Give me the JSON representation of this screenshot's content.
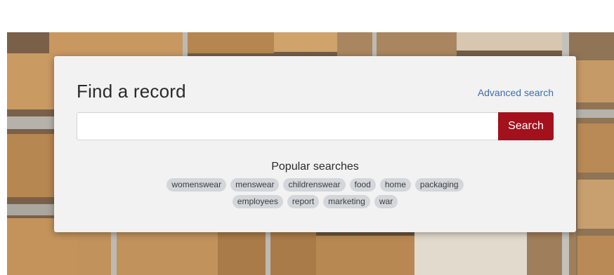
{
  "card": {
    "title": "Find a record",
    "advanced_search_label": "Advanced search"
  },
  "search": {
    "value": "",
    "placeholder": "",
    "button_label": "Search"
  },
  "popular": {
    "title": "Popular searches",
    "row1": [
      "womenswear",
      "menswear",
      "childrenswear",
      "food",
      "home",
      "packaging"
    ],
    "row2": [
      "employees",
      "report",
      "marketing",
      "war"
    ]
  },
  "colors": {
    "search_button": "#a3111c",
    "link": "#3a6fb0",
    "card_background": "#f2f2f2",
    "tag_background": "#d3d6da"
  }
}
